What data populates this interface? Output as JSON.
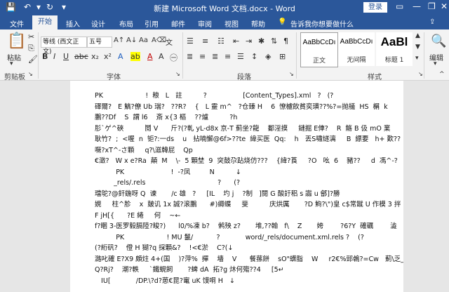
{
  "titlebar": {
    "title": "新建 Microsoft Word 文档.docx - Word",
    "login_label": "登录",
    "icons": [
      "save-icon",
      "undo-icon",
      "redo-icon",
      "customize-qat-icon",
      "ribbon-display-icon",
      "minimize-icon",
      "restore-icon",
      "close-icon"
    ]
  },
  "tabs": [
    "文件",
    "开始",
    "插入",
    "设计",
    "布局",
    "引用",
    "邮件",
    "审阅",
    "视图",
    "帮助"
  ],
  "active_tab": "开始",
  "tell_me": "告诉我你想要做什么",
  "ribbon": {
    "clipboard": {
      "paste_label": "粘贴",
      "group_label": "剪贴板"
    },
    "font": {
      "font_name": "等线 (西文正文)",
      "font_size": "五号",
      "group_label": "字体"
    },
    "paragraph": {
      "group_label": "段落"
    },
    "styles": {
      "group_label": "样式",
      "items": [
        {
          "sample": "AaBbCcDı",
          "name": "正文"
        },
        {
          "sample": "AaBbCcDı",
          "name": "无间隔"
        },
        {
          "sample": "AaBl",
          "name": "标题 1"
        }
      ]
    },
    "editing": {
      "label": "编辑"
    }
  },
  "document": {
    "lines": [
      "PK                    !  粮   L   註          ?                 [Content_Types].xml   ?   (?",
      "礋爾?   E 鰝?僚 Ub 瑞?   ??R?    {   L 靈 m^   ?仓臻 H    6  憭櫨飲貧奕璜??%?=抛艤  HS  榍  k",
      "鵬??Df    S  謂 l6    斎 x{3 樞    ??爐          ?h",
      "肜`ゲ^硤          鬩 V      斤?(?軋 yL-d8x 京-T 薊坐?龍    鄱淫摸     鏈掘 E俥?    R  觞 B 伋 mO 業",
      "耿竹?  ;  <喔  n  钜?:一ds    u   拈喃懈@6f>??te  緯买医  Qq:    h   丟S嘯燧漓     B  縹要   h+ 歎??",
      "噘?xT^-さ顆     q?\\滋韓屁    Qp  ",
      "€澂?   W x e?Ra  顛  M    \\-  5 顆埜  9  突鼓尕跕烧仿???    {緯?莨     ?O   吆  6    豬??     d  馮^-?",
      "          PK                      !  -?凤         N          ↓",
      "         _rels/.rels                                  ?      (?",
      "璫鸵?@釬鍦呀 Q  谏       /c 雄   ?     [IL    圴 j    ?制   ]閱 G 酸訏稆 s 讟 u 鄶]?勝",
      "娊     柱^胗    x  皷讥 1x 誠?滚鵬      #)縟蝶     斐          庆烘厲       ?D 鮈?\\\")皇 c$常蹴 U 作模 3 拌 1",
      "F jH[{      ?E 綣     何    ~←",
      "f?睏 3-医罗毅膈陸?睃?)      l0/%凍 b?    鸺殃 z?       堆,??翰   f\\    Z       姱        ?6?Y  確礪        澁   A?",
      "          PK                    ! MU 鬣/           ?            word/_rels/document.xml.rels ?    (?",
      "(?絎矾?    僜 H 猢?q 採顆&?    !<€淤    C?(↓",
      "潞叱確 E?X9 頗炷 4+(国    )?萍%  撣    墻    V      餐蓀餅    sO\"蠎脂    W     r2€%郖鵫?=Cw   薊\\乏_笻涞",
      "Q?Rj?    潮?軼     ˋ鐵蜆飼       ?蜱 dA  拓?g 炑何殤??4     [5↵",
      "   IU[            /DP.\\?d?葸€昆?竃 uK 馍哃 H   ↓"
    ]
  },
  "colors": {
    "title_bar": "#2b579a",
    "ribbon_bg": "#f3f3f3",
    "doc_bg": "#e6e6e6",
    "page_bg": "#ffffff"
  }
}
